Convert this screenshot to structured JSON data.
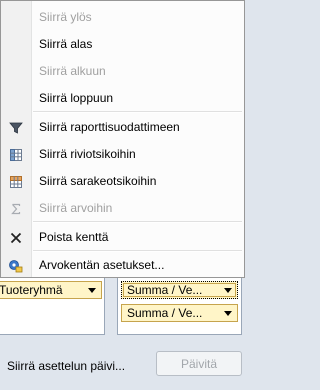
{
  "menu": {
    "items": [
      {
        "label": "Siirrä ylös",
        "enabled": false,
        "icon": ""
      },
      {
        "label": "Siirrä alas",
        "enabled": true,
        "icon": ""
      },
      {
        "label": "Siirrä alkuun",
        "enabled": false,
        "icon": ""
      },
      {
        "label": "Siirrä loppuun",
        "enabled": true,
        "icon": ""
      },
      {
        "label": "Siirrä raporttisuodattimeen",
        "enabled": true,
        "icon": "filter-icon"
      },
      {
        "label": "Siirrä riviotsikoihin",
        "enabled": true,
        "icon": "row-labels-icon"
      },
      {
        "label": "Siirrä sarakeotsikoihin",
        "enabled": true,
        "icon": "column-labels-icon"
      },
      {
        "label": "Siirrä arvoihin",
        "enabled": false,
        "icon": "sigma-icon"
      },
      {
        "label": "Poista kenttä",
        "enabled": true,
        "icon": "delete-icon"
      },
      {
        "label": "Arvokentän asetukset...",
        "enabled": true,
        "icon": "field-settings-icon"
      }
    ]
  },
  "field_areas": {
    "row_field": "Tuoteryhmä",
    "value_fields": [
      "Summa / Ve...",
      "Summa / Ve..."
    ]
  },
  "footer": {
    "defer_label": "Siirrä asettelun päivi...",
    "update_button": "Päivitä"
  },
  "colors": {
    "menu_background": "#fcfcfc",
    "menu_gutter": "#f1f1f1",
    "disabled_text": "#a0a0a0",
    "chip_fill": "#fff5c8",
    "chip_border": "#c6a44d",
    "panel_background": "#dfe5ed"
  }
}
